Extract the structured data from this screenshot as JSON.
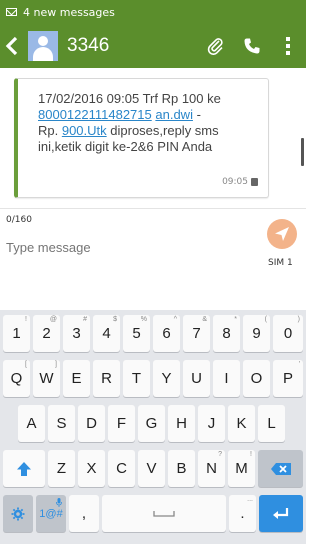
{
  "status_bar": {
    "notification_text": "4 new messages"
  },
  "header": {
    "title": "3346"
  },
  "message": {
    "line1": "17/02/2016 09:05 Trf Rp 100 ke",
    "link_account": "8000122111482715",
    "link_name": "an.dwi",
    "text_dash": " -",
    "text_rp": "Rp. ",
    "link_amount": "900.Utk",
    "line3_rest": " diproses,reply sms",
    "line4": "ini,ketik digit ke-2&6 PIN Anda",
    "time": "09:05"
  },
  "compose": {
    "counter": "0/160",
    "placeholder": "Type message",
    "sim_label": "SIM 1"
  },
  "keyboard": {
    "row1": [
      {
        "k": "1",
        "s": "!"
      },
      {
        "k": "2",
        "s": "@"
      },
      {
        "k": "3",
        "s": "#"
      },
      {
        "k": "4",
        "s": "$"
      },
      {
        "k": "5",
        "s": "%"
      },
      {
        "k": "6",
        "s": "^"
      },
      {
        "k": "7",
        "s": "&"
      },
      {
        "k": "8",
        "s": "*"
      },
      {
        "k": "9",
        "s": "("
      },
      {
        "k": "0",
        "s": ")"
      }
    ],
    "row2": [
      {
        "k": "Q",
        "s": "["
      },
      {
        "k": "W",
        "s": "]"
      },
      {
        "k": "E",
        "s": ""
      },
      {
        "k": "R",
        "s": ""
      },
      {
        "k": "T",
        "s": ""
      },
      {
        "k": "Y",
        "s": ""
      },
      {
        "k": "U",
        "s": ""
      },
      {
        "k": "I",
        "s": ""
      },
      {
        "k": "O",
        "s": ""
      },
      {
        "k": "P",
        "s": "'"
      }
    ],
    "row3": [
      {
        "k": "A",
        "s": ""
      },
      {
        "k": "S",
        "s": ""
      },
      {
        "k": "D",
        "s": ""
      },
      {
        "k": "F",
        "s": ""
      },
      {
        "k": "G",
        "s": ""
      },
      {
        "k": "H",
        "s": ""
      },
      {
        "k": "J",
        "s": ""
      },
      {
        "k": "K",
        "s": ""
      },
      {
        "k": "L",
        "s": ""
      }
    ],
    "row4": [
      {
        "k": "Z",
        "s": ""
      },
      {
        "k": "X",
        "s": ""
      },
      {
        "k": "C",
        "s": ""
      },
      {
        "k": "V",
        "s": ""
      },
      {
        "k": "B",
        "s": ""
      },
      {
        "k": "N",
        "s": "?"
      },
      {
        "k": "M",
        "s": "!"
      }
    ],
    "symbols_key": "1@#",
    "comma_key": ",",
    "period_key": ".",
    "period_sub": "...",
    "accent_color": "#2f8fe0",
    "icons": {
      "shift": "shift-arrow-icon",
      "backspace": "backspace-icon",
      "settings": "gear-icon",
      "mic": "mic-icon",
      "enter": "enter-icon",
      "space": "space-bar-icon"
    }
  },
  "colors": {
    "app_bar": "#5b8e2c",
    "bubble_accent": "#6b9e3b",
    "send_button": "#f3b38a",
    "link": "#2a86c9"
  }
}
